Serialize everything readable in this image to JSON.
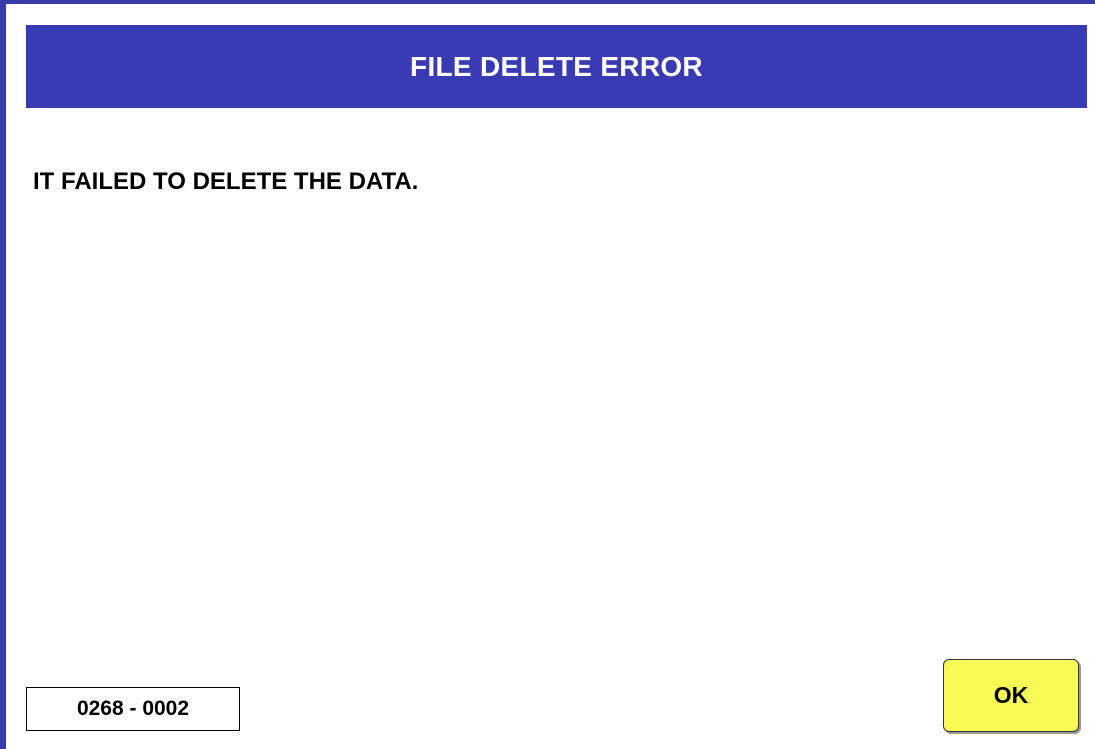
{
  "dialog": {
    "title": "FILE DELETE ERROR",
    "message": "IT FAILED TO DELETE THE DATA.",
    "error_code": "0268 - 0002",
    "ok_label": "OK"
  },
  "colors": {
    "title_bar": "#3a3ab2",
    "frame_border": "#3a3aa8",
    "ok_button": "#f8fb55",
    "title_text": "#ffffff",
    "body_text": "#000000"
  }
}
